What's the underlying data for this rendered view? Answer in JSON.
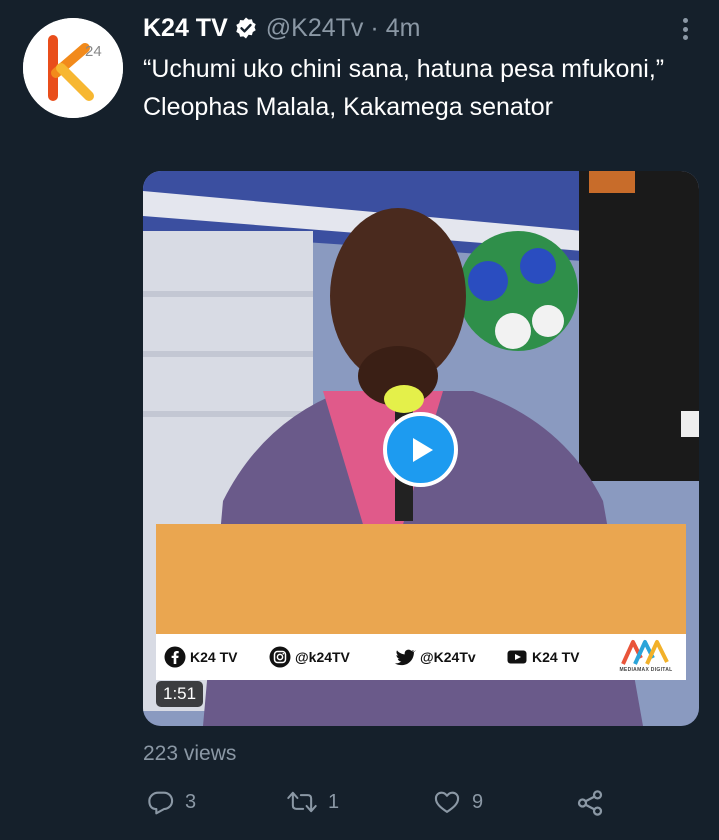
{
  "tweet": {
    "author": {
      "display_name": "K24 TV",
      "handle": "@K24Tv",
      "verified": true,
      "avatar_icon": "k24-logo"
    },
    "separator": "·",
    "timestamp": "4m",
    "text": "“Uchumi uko chini sana, hatuna pesa mfukoni,” Cleophas Malala, Kakamega senator",
    "media": {
      "type": "video",
      "duration": "1:51",
      "play_icon": "play-icon",
      "overlay": {
        "facebook": "K24 TV",
        "instagram": "@k24TV",
        "twitter": "@K24Tv",
        "youtube": "K24 TV",
        "brand_logo": "MEDIAMAX DIGITAL"
      }
    },
    "views": "223 views",
    "actions": {
      "reply_count": "3",
      "retweet_count": "1",
      "like_count": "9"
    }
  },
  "colors": {
    "background": "#15202b",
    "text_primary": "#ffffff",
    "text_secondary": "#8b98a5",
    "accent": "#1d9bf0",
    "overlay_orange": "#eaa650"
  }
}
